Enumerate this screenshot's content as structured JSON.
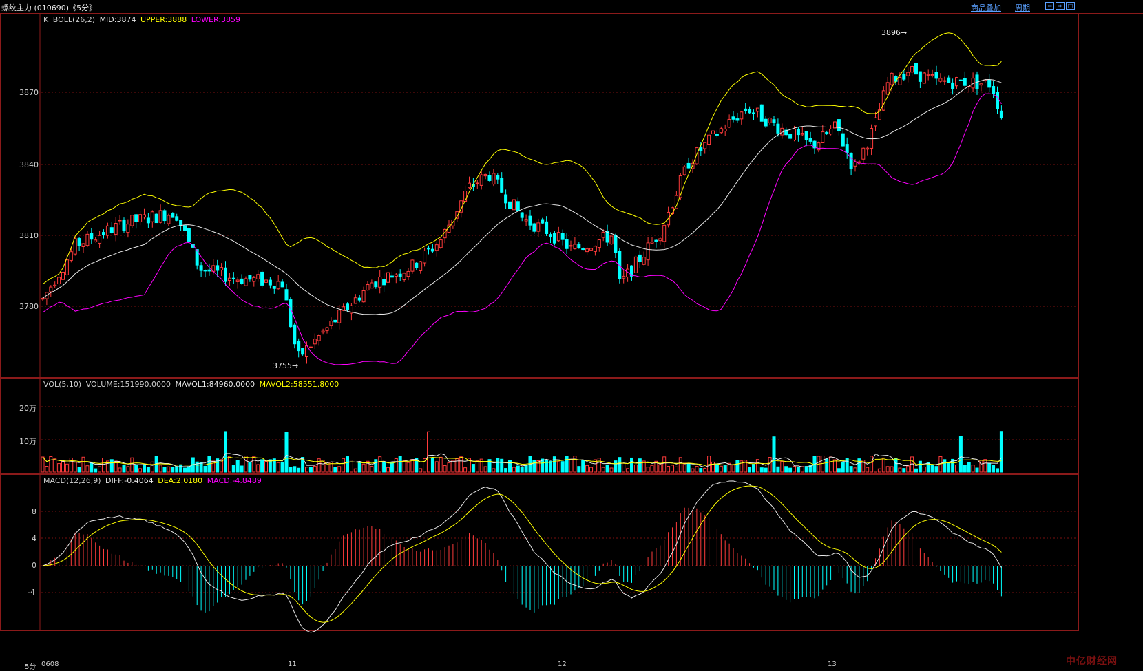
{
  "title": "螺纹主力 (010690)《5分》",
  "buttons": {
    "overlay": "商品叠加",
    "period": "周期"
  },
  "win_buttons": [
    "⇦",
    "⇨",
    "□"
  ],
  "k_panel": {
    "legend": {
      "name": "K",
      "indicator": "BOLL(26,2)",
      "mid": "MID:3874",
      "upper": "UPPER:3888",
      "lower": "LOWER:3859"
    },
    "y_ticks": [
      "3870",
      "3840",
      "3810",
      "3780"
    ],
    "high_label": "3896→",
    "low_label": "3755→"
  },
  "vol_panel": {
    "legend": {
      "name": "VOL(5,10)",
      "volume": "VOLUME:151990.0000",
      "mavol1": "MAVOL1:84960.0000",
      "mavol2": "MAVOL2:58551.8000"
    },
    "y_ticks": [
      "20万",
      "10万"
    ]
  },
  "macd_panel": {
    "legend": {
      "name": "MACD(12,26,9)",
      "diff": "DIFF:-0.4064",
      "dea": "DEA:2.0180",
      "macd": "MACD:-4.8489"
    },
    "y_ticks": [
      "8",
      "4",
      "0",
      "-4"
    ]
  },
  "x_axis": {
    "period": "5分",
    "labels": [
      "0608",
      "11",
      "12",
      "13"
    ]
  },
  "watermark": "中亿财经网",
  "colors": {
    "up": "#ff3b3b",
    "down": "#00ffff",
    "mid": "#e8e8e8",
    "upper": "#ffff00",
    "lower": "#ff00ff",
    "grid": "#7a1010"
  },
  "chart_data": {
    "type": "candlestick",
    "price_range": [
      3750,
      3900
    ],
    "high": 3896,
    "low": 3755,
    "boll_latest": {
      "mid": 3874,
      "upper": 3888,
      "lower": 3859
    },
    "volume_latest": {
      "volume": 151990,
      "mavol1": 84960,
      "mavol2": 58551.8
    },
    "macd_latest": {
      "diff": -0.4064,
      "dea": 2.018,
      "macd": -4.8489
    }
  }
}
